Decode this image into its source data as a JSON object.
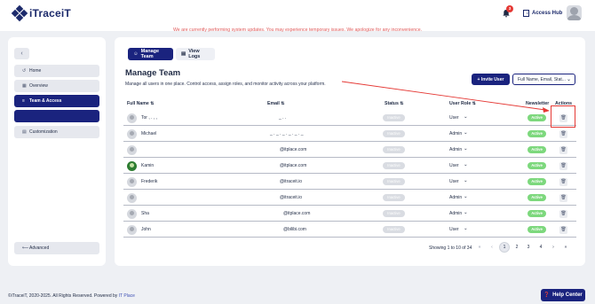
{
  "header": {
    "brand": "iTraceiT",
    "notice": "We are currently performing system updates. You may experience temporary issues. We apologize for any inconvenience.",
    "notification_count": "3",
    "access_hub_label": "Access Hub"
  },
  "sidebar": {
    "collapse_icon": "‹",
    "items": [
      {
        "label": "Home",
        "icon": "↺"
      },
      {
        "label": "Overview",
        "icon": "▦"
      },
      {
        "label": "Team & Access",
        "icon": "≡"
      },
      {
        "label": ""
      },
      {
        "label": "Customization",
        "icon": "▤"
      }
    ],
    "advanced_label": "Advanced",
    "advanced_icon": "⟵"
  },
  "tabs": {
    "manage": "Manage Team",
    "logs": "View Logs"
  },
  "main": {
    "title": "Manage Team",
    "subtitle": "Manage all users in one place. Control access, assign roles, and monitor activity across your platform.",
    "invite_label": "+ Invite User",
    "filter_value": "Full Name, Email, Stat..."
  },
  "table": {
    "headers": {
      "full_name": "Full Name ⇅",
      "email": "Email ⇅",
      "status": "Status ⇅",
      "user_role": "User Role ⇅",
      "newsletter": "Newsletter",
      "actions": "Actions"
    },
    "rows": [
      {
        "name": "Tor ,  .  ,  ,",
        "email": "_  .  .",
        "status": "Inactive",
        "role": "User",
        "newsletter": "Active"
      },
      {
        "name": "Michael",
        "email": "_ . _ . _ . _ . _ . _",
        "status": "Inactive",
        "role": "Admin",
        "newsletter": "Active"
      },
      {
        "name": "",
        "email": "@itplace.com",
        "status": "Inactive",
        "role": "Admin",
        "newsletter": "Active"
      },
      {
        "name": "Kamin",
        "email": "@itplace.com",
        "status": "Inactive",
        "role": "User",
        "newsletter": "Active"
      },
      {
        "name": "Frederik",
        "email": "@itraceit.io",
        "status": "Inactive",
        "role": "User",
        "newsletter": "Active"
      },
      {
        "name": "",
        "email": "@itraceit.io",
        "status": "Inactive",
        "role": "Admin",
        "newsletter": "Active"
      },
      {
        "name": "Sha",
        "email": "@itplace.com",
        "status": "Inactive",
        "role": "Admin",
        "newsletter": "Active"
      },
      {
        "name": "John",
        "email": "@bilibi.com",
        "status": "Inactive",
        "role": "User",
        "newsletter": "Active"
      }
    ]
  },
  "pagination": {
    "showing": "Showing 1 to 10 of 34",
    "first": "«",
    "prev": "‹",
    "pages": [
      "1",
      "2",
      "3",
      "4"
    ],
    "next": "›",
    "last": "»"
  },
  "footer": {
    "copyright": "©iTraceiT, 2020-2025. All Rights Reserved. Powered by ",
    "powered_by": "IT Place",
    "help_label": "Help Center"
  },
  "colors": {
    "accent": "#1a237e",
    "notice": "#e05a5a",
    "active_badge": "#7dd87d",
    "highlight": "#e53935"
  }
}
